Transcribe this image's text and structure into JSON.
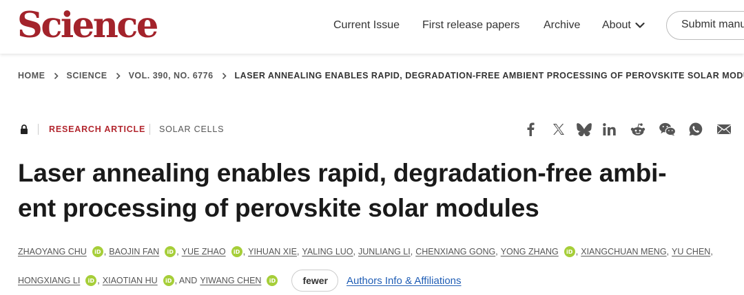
{
  "header": {
    "logo": "Science",
    "nav": [
      "Current Issue",
      "First release papers",
      "Archive",
      "About"
    ],
    "submit_label": "Submit manu"
  },
  "breadcrumb": [
    "HOME",
    "SCIENCE",
    "VOL. 390, NO. 6776",
    "LASER ANNEALING ENABLES RAPID, DEGRADATION-FREE AMBIENT PROCESSING OF PEROVSKITE SOLAR MODULES"
  ],
  "article": {
    "type": "RESEARCH ARTICLE",
    "subject": "SOLAR CELLS",
    "title_lines": [
      "Laser annealing enables rapid, degradation-free ambi-",
      "ent processing of perovskite solar modules"
    ]
  },
  "share_icons": [
    "facebook-icon",
    "x-icon",
    "bluesky-icon",
    "linkedin-icon",
    "reddit-icon",
    "wechat-icon",
    "whatsapp-icon",
    "email-icon"
  ],
  "authors": {
    "row1": [
      {
        "name": "ZHAOYANG CHU",
        "orcid": true,
        "sep": ","
      },
      {
        "name": "BAOJIN FAN",
        "orcid": true,
        "sep": ","
      },
      {
        "name": "YUE ZHAO",
        "orcid": true,
        "sep": ","
      },
      {
        "name": "YIHUAN XIE",
        "orcid": false,
        "sep": ","
      },
      {
        "name": "YALING LUO",
        "orcid": false,
        "sep": ","
      },
      {
        "name": "JUNLIANG LI",
        "orcid": false,
        "sep": ","
      },
      {
        "name": "CHENXIANG GONG",
        "orcid": false,
        "sep": ","
      },
      {
        "name": "YONG ZHANG",
        "orcid": true,
        "sep": ","
      },
      {
        "name": "XIANGCHUAN MENG",
        "orcid": false,
        "sep": ","
      },
      {
        "name": "YU CHEN",
        "orcid": false,
        "sep": ","
      }
    ],
    "row2": [
      {
        "name": "HONGXIANG LI",
        "orcid": true,
        "sep": ","
      },
      {
        "name": "XIAOTIAN HU",
        "orcid": true,
        "sep": ", AND"
      },
      {
        "name": "YIWANG CHEN",
        "orcid": true,
        "sep": ""
      }
    ],
    "orcid_badge": "iD",
    "fewer_label": "fewer",
    "affiliations_link": "Authors Info & Affiliations"
  }
}
